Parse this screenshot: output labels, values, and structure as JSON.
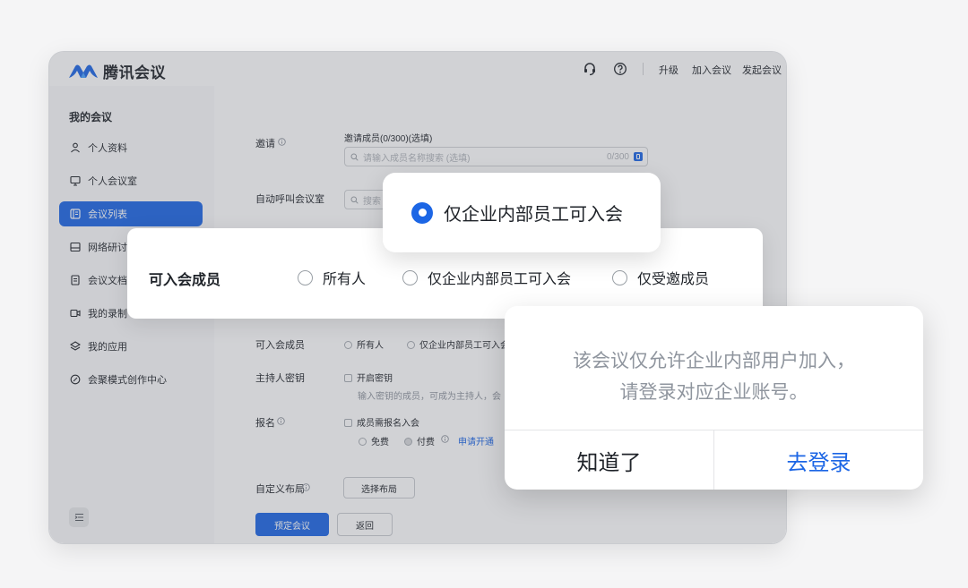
{
  "app": {
    "title": "腾讯会议"
  },
  "topbar": {
    "icons": [
      "support-icon",
      "help-icon"
    ],
    "links": [
      "升级",
      "加入会议",
      "发起会议"
    ]
  },
  "sidebar": {
    "section_title": "我的会议",
    "items": [
      {
        "label": "个人资料",
        "icon": "user-icon",
        "active": false
      },
      {
        "label": "个人会议室",
        "icon": "room-icon",
        "active": false
      },
      {
        "label": "会议列表",
        "icon": "list-icon",
        "active": true
      },
      {
        "label": "网络研讨会",
        "icon": "webinar-icon",
        "active": false
      },
      {
        "label": "会议文档",
        "icon": "document-icon",
        "active": false
      },
      {
        "label": "我的录制",
        "icon": "record-icon",
        "active": false
      },
      {
        "label": "我的应用",
        "icon": "apps-icon",
        "active": false
      },
      {
        "label": "会聚模式创作中心",
        "icon": "creation-icon",
        "active": false
      }
    ]
  },
  "form": {
    "invite": {
      "label": "邀请",
      "sub_label": "邀请成员(0/300)(选填)",
      "placeholder": "请输入成员名称搜索 (选填)",
      "count": "0/300"
    },
    "auto_call": {
      "label": "自动呼叫会议室",
      "placeholder": "搜索"
    },
    "members": {
      "label": "可入会成员",
      "options": [
        "所有人",
        "仅企业内部员工可入会"
      ]
    },
    "host_key": {
      "label": "主持人密钥",
      "checkbox": "开启密钥",
      "hint": "输入密钥的成员，可成为主持人，会"
    },
    "signup": {
      "label": "报名",
      "checkbox": "成员需报名入会",
      "free": "免费",
      "paid": "付费",
      "apply_link": "申请开通"
    },
    "layout": {
      "label": "自定义布局",
      "button": "选择布局"
    },
    "actions": {
      "submit": "预定会议",
      "back": "返回"
    }
  },
  "callout": {
    "label": "可入会成员",
    "options": [
      "所有人",
      "仅企业内部员工可入会",
      "仅受邀成员"
    ]
  },
  "selected_bubble": {
    "text": "仅企业内部员工可入会"
  },
  "dialog": {
    "line1": "该会议仅允许企业内部用户加入，",
    "line2": "请登录对应企业账号。",
    "cancel": "知道了",
    "confirm": "去登录"
  },
  "colors": {
    "accent": "#1c66e5",
    "muted_text": "#8f959e",
    "primary_text": "#1f2329"
  }
}
